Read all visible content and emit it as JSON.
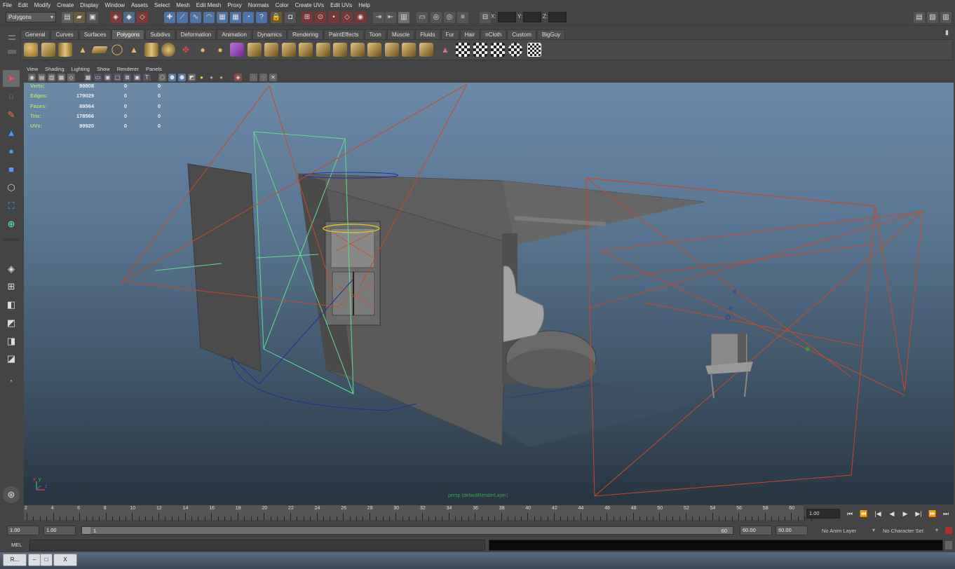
{
  "menu": [
    "File",
    "Edit",
    "Modify",
    "Create",
    "Display",
    "Window",
    "Assets",
    "Select",
    "Mesh",
    "Edit Mesh",
    "Proxy",
    "Normals",
    "Color",
    "Create UVs",
    "Edit UVs",
    "Help"
  ],
  "status_line": {
    "mode": "Polygons",
    "x_label": "X:",
    "y_label": "Y:",
    "z_label": "Z:"
  },
  "shelf_tabs": [
    "General",
    "Curves",
    "Surfaces",
    "Polygons",
    "Subdivs",
    "Deformation",
    "Animation",
    "Dynamics",
    "Rendering",
    "PaintEffects",
    "Toon",
    "Muscle",
    "Fluids",
    "Fur",
    "Hair",
    "nCloth",
    "Custom",
    "BigGuy"
  ],
  "shelf_active": "Polygons",
  "panel_menu": [
    "View",
    "Shading",
    "Lighting",
    "Show",
    "Renderer",
    "Panels"
  ],
  "hud": [
    {
      "label": "Verts:",
      "v1": "89808",
      "v2": "0",
      "v3": "0"
    },
    {
      "label": "Edges:",
      "v1": "179029",
      "v2": "0",
      "v3": "0"
    },
    {
      "label": "Faces:",
      "v1": "89564",
      "v2": "0",
      "v3": "0"
    },
    {
      "label": "Tris:",
      "v1": "178566",
      "v2": "0",
      "v3": "0"
    },
    {
      "label": "UVs:",
      "v1": "99920",
      "v2": "0",
      "v3": "0"
    }
  ],
  "viewport_layer_label": "persp (defaultRenderLayer)",
  "axis": {
    "x": "x",
    "y": "y",
    "z": "z"
  },
  "timeline": {
    "ticks": [
      "2",
      "4",
      "6",
      "8",
      "10",
      "12",
      "14",
      "16",
      "18",
      "20",
      "22",
      "24",
      "26",
      "28",
      "30",
      "32",
      "34",
      "36",
      "38",
      "40",
      "42",
      "44",
      "46",
      "48",
      "50",
      "52",
      "54",
      "56",
      "58",
      "60"
    ],
    "current_frame": "1.00"
  },
  "range": {
    "start_time": "1.00",
    "playback_start": "1.00",
    "slider_start": "1",
    "slider_end": "60",
    "playback_end": "60.00",
    "end_time": "60.00",
    "anim_layer": "No Anim Layer",
    "character_set": "No Character Set"
  },
  "command_line": {
    "label": "MEL"
  },
  "taskbar": {
    "app_label": "R...",
    "btn2": "□",
    "btn3": "X"
  },
  "colors": {
    "hud_label": "#a7e07a",
    "camera_lines": "#c8482a",
    "selected": "#5ee08a",
    "manip": "#1f2f9a"
  }
}
